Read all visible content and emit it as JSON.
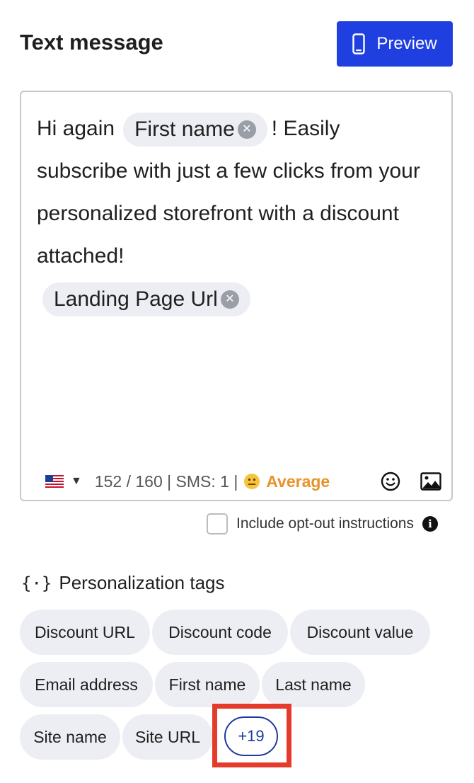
{
  "header": {
    "title": "Text message",
    "preview_label": "Preview",
    "preview_icon": "mobile-phone-icon"
  },
  "editor": {
    "text_before_first_tag": "Hi again",
    "first_tag": "First name",
    "text_after_first_tag": "! Easily subscribe with just a few clicks from your personalized storefront with a discount attached!",
    "second_tag": "Landing Page Url",
    "footer": {
      "country_flag": "us-flag-icon",
      "char_count": "152 / 160 | SMS: 1 |",
      "quality_label": "Average",
      "quality_color": "#e8922b"
    }
  },
  "optout": {
    "label": "Include opt-out instructions",
    "checked": false
  },
  "personalization": {
    "title": "Personalization tags",
    "tags": [
      "Discount URL",
      "Discount code",
      "Discount value",
      "Email address",
      "First name",
      "Last name",
      "Site name",
      "Site URL"
    ],
    "more_label": "+19"
  },
  "colors": {
    "primary": "#1f3fe0",
    "chip_bg": "#eceef3",
    "highlight": "#e53b2c"
  }
}
